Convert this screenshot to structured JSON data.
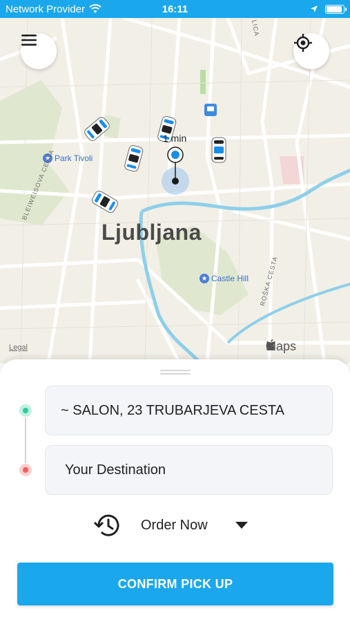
{
  "status_bar": {
    "carrier": "Network Provider",
    "time": "16:11",
    "wifi_icon": "wifi-icon",
    "location_icon": "location-arrow-icon",
    "battery_level": 0.9
  },
  "map": {
    "city": "Ljubljana",
    "pois": [
      {
        "label": "Park Tivoli"
      },
      {
        "label": "Castle Hill"
      }
    ],
    "streets": [
      "BLEIWEISOVA CESTA",
      "ROŠKA CESTA",
      "LICA"
    ],
    "eta": "1 min",
    "legal": "Legal",
    "maps_brand": "Maps",
    "menu_icon": "hamburger-menu-icon",
    "locate_icon": "crosshair-icon"
  },
  "booking": {
    "pickup_value": "~ SALON, 23 TRUBARJEVA CESTA",
    "destination_placeholder": "Your Destination",
    "order_label": "Order Now",
    "order_icon": "history-icon",
    "confirm_label": "CONFIRM PICK UP"
  },
  "colors": {
    "accent": "#1aa7ec",
    "pickup_dot": "#34c79a",
    "dest_dot": "#f26060"
  }
}
